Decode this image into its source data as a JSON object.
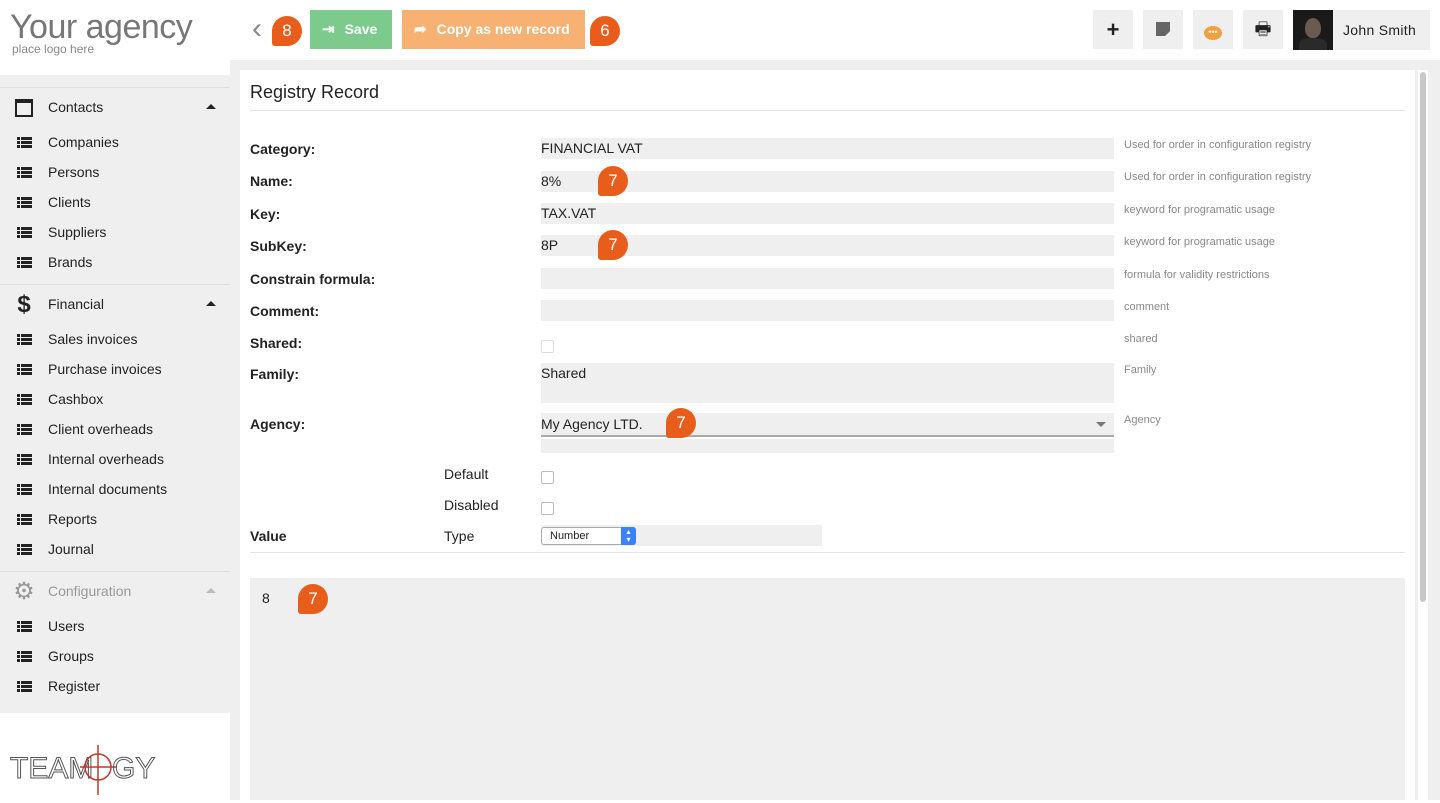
{
  "logo": {
    "main": "Your agency",
    "sub": "place logo here"
  },
  "toolbar": {
    "save_label": "Save",
    "copy_label": "Copy as new record",
    "back_badge": "8",
    "copy_badge": "6"
  },
  "user": {
    "name": "John Smith"
  },
  "sidebar": {
    "sections": [
      {
        "label": "Contacts",
        "items": [
          "Companies",
          "Persons",
          "Clients",
          "Suppliers",
          "Brands"
        ]
      },
      {
        "label": "Financial",
        "items": [
          "Sales invoices",
          "Purchase invoices",
          "Cashbox",
          "Client overheads",
          "Internal overheads",
          "Internal documents",
          "Reports",
          "Journal"
        ]
      },
      {
        "label": "Configuration",
        "items": [
          "Users",
          "Groups",
          "Register"
        ]
      }
    ],
    "footer_logo": "TEAMOGY"
  },
  "form": {
    "title": "Registry Record",
    "category": {
      "label": "Category:",
      "value": "FINANCIAL VAT",
      "hint": "Used for order in configuration registry"
    },
    "name": {
      "label": "Name:",
      "value": "8%",
      "hint": "Used for order in configuration registry",
      "badge": "7"
    },
    "key": {
      "label": "Key:",
      "value": "TAX.VAT",
      "hint": "keyword for programatic usage"
    },
    "subkey": {
      "label": "SubKey:",
      "value": "8P",
      "hint": "keyword for programatic usage",
      "badge": "7"
    },
    "constrain": {
      "label": "Constrain formula:",
      "value": "",
      "hint": "formula for validity restrictions"
    },
    "comment": {
      "label": "Comment:",
      "value": "",
      "hint": "comment"
    },
    "shared": {
      "label": "Shared:",
      "hint": "shared"
    },
    "family": {
      "label": "Family:",
      "value": "Shared",
      "hint": "Family"
    },
    "agency": {
      "label": "Agency:",
      "value": "My Agency LTD.",
      "hint": "Agency",
      "badge": "7"
    },
    "default_label": "Default",
    "disabled_label": "Disabled",
    "value_label": "Value",
    "type_label": "Type",
    "type_value": "Number",
    "value_content": "8",
    "value_badge": "7"
  }
}
